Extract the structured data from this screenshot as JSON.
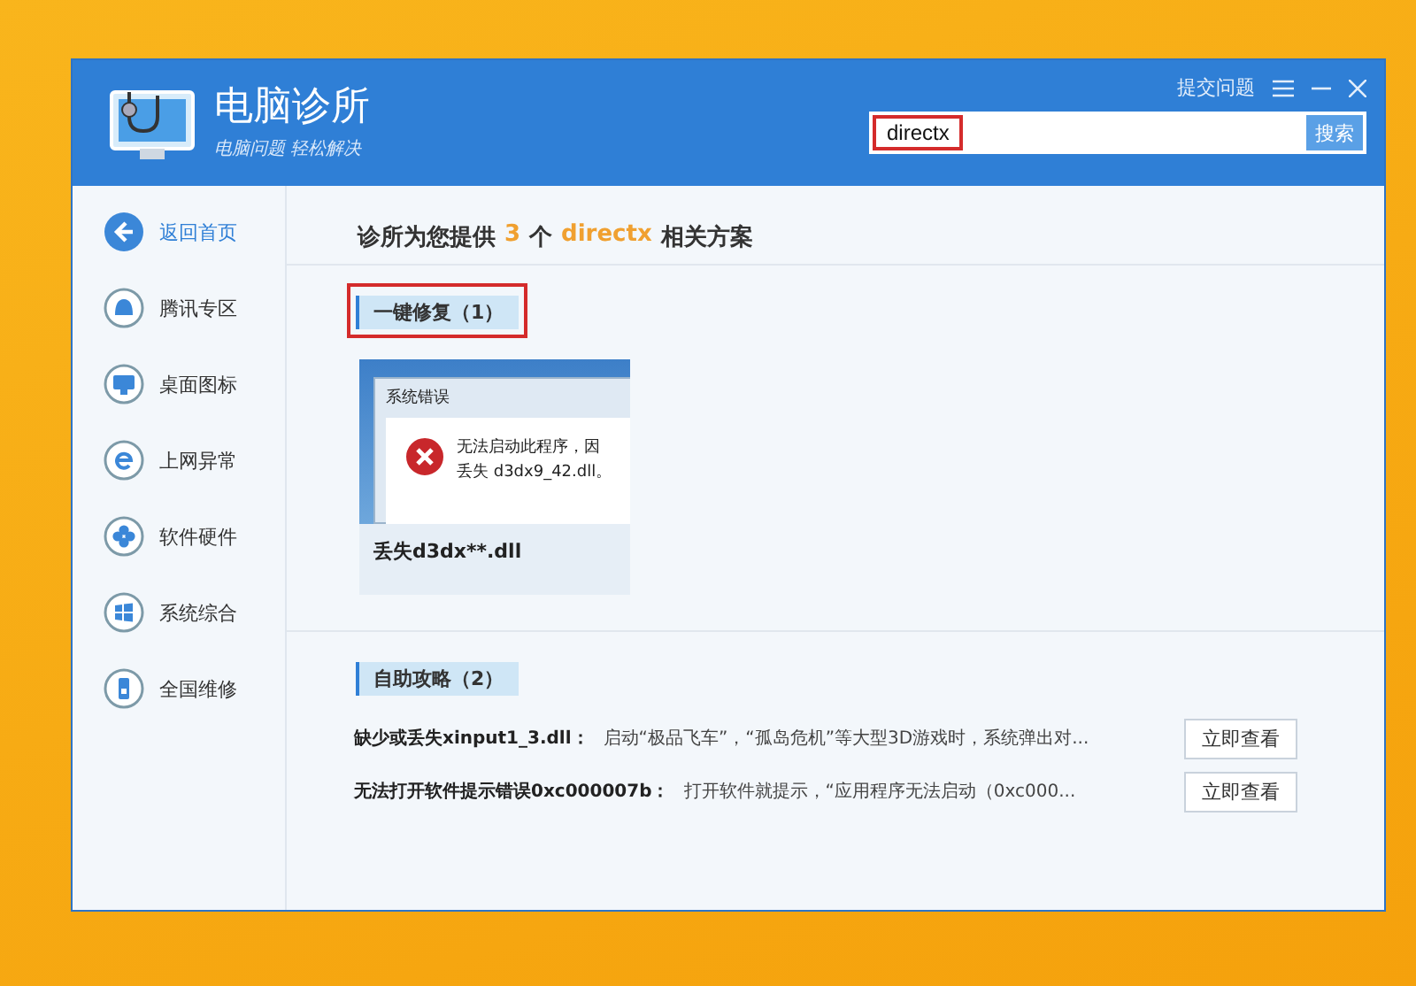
{
  "window": {
    "app_title": "电脑诊所",
    "app_slogan": "电脑问题 轻松解决",
    "feedback_link": "提交问题"
  },
  "search": {
    "value": "directx",
    "highlighted": true,
    "button": "搜索"
  },
  "sidebar": {
    "items": [
      {
        "label": "返回首页",
        "kind": "back"
      },
      {
        "label": "腾讯专区",
        "kind": "category"
      },
      {
        "label": "桌面图标",
        "kind": "category"
      },
      {
        "label": "上网异常",
        "kind": "category"
      },
      {
        "label": "软件硬件",
        "kind": "category"
      },
      {
        "label": "系统综合",
        "kind": "category"
      },
      {
        "label": "全国维修",
        "kind": "category"
      }
    ]
  },
  "summary": {
    "prefix": "诊所为您提供",
    "count": "3",
    "unit": "个",
    "query": "directx",
    "suffix": "相关方案"
  },
  "one_click_fix": {
    "heading": "一键修复（1）",
    "highlighted": true,
    "cards": [
      {
        "dialog_title": "系统错误",
        "dialog_line_1": "无法启动此程序，因",
        "dialog_line_2": "丢失 d3dx9_42.dll。",
        "caption": "丢失d3dx**.dll"
      }
    ]
  },
  "self_help": {
    "heading": "自助攻略（2）",
    "highlighted": false,
    "rows": [
      {
        "title": "缺少或丢失xinput1_3.dll：",
        "summary": "启动“极品飞车”，“孤岛危机”等大型3D游戏时，系统弹出对...",
        "button": "立即查看"
      },
      {
        "title": "无法打开软件提示错误0xc000007b：",
        "summary": "打开软件就提示，“应用程序无法启动（0xc000...",
        "button": "立即查看"
      }
    ]
  }
}
